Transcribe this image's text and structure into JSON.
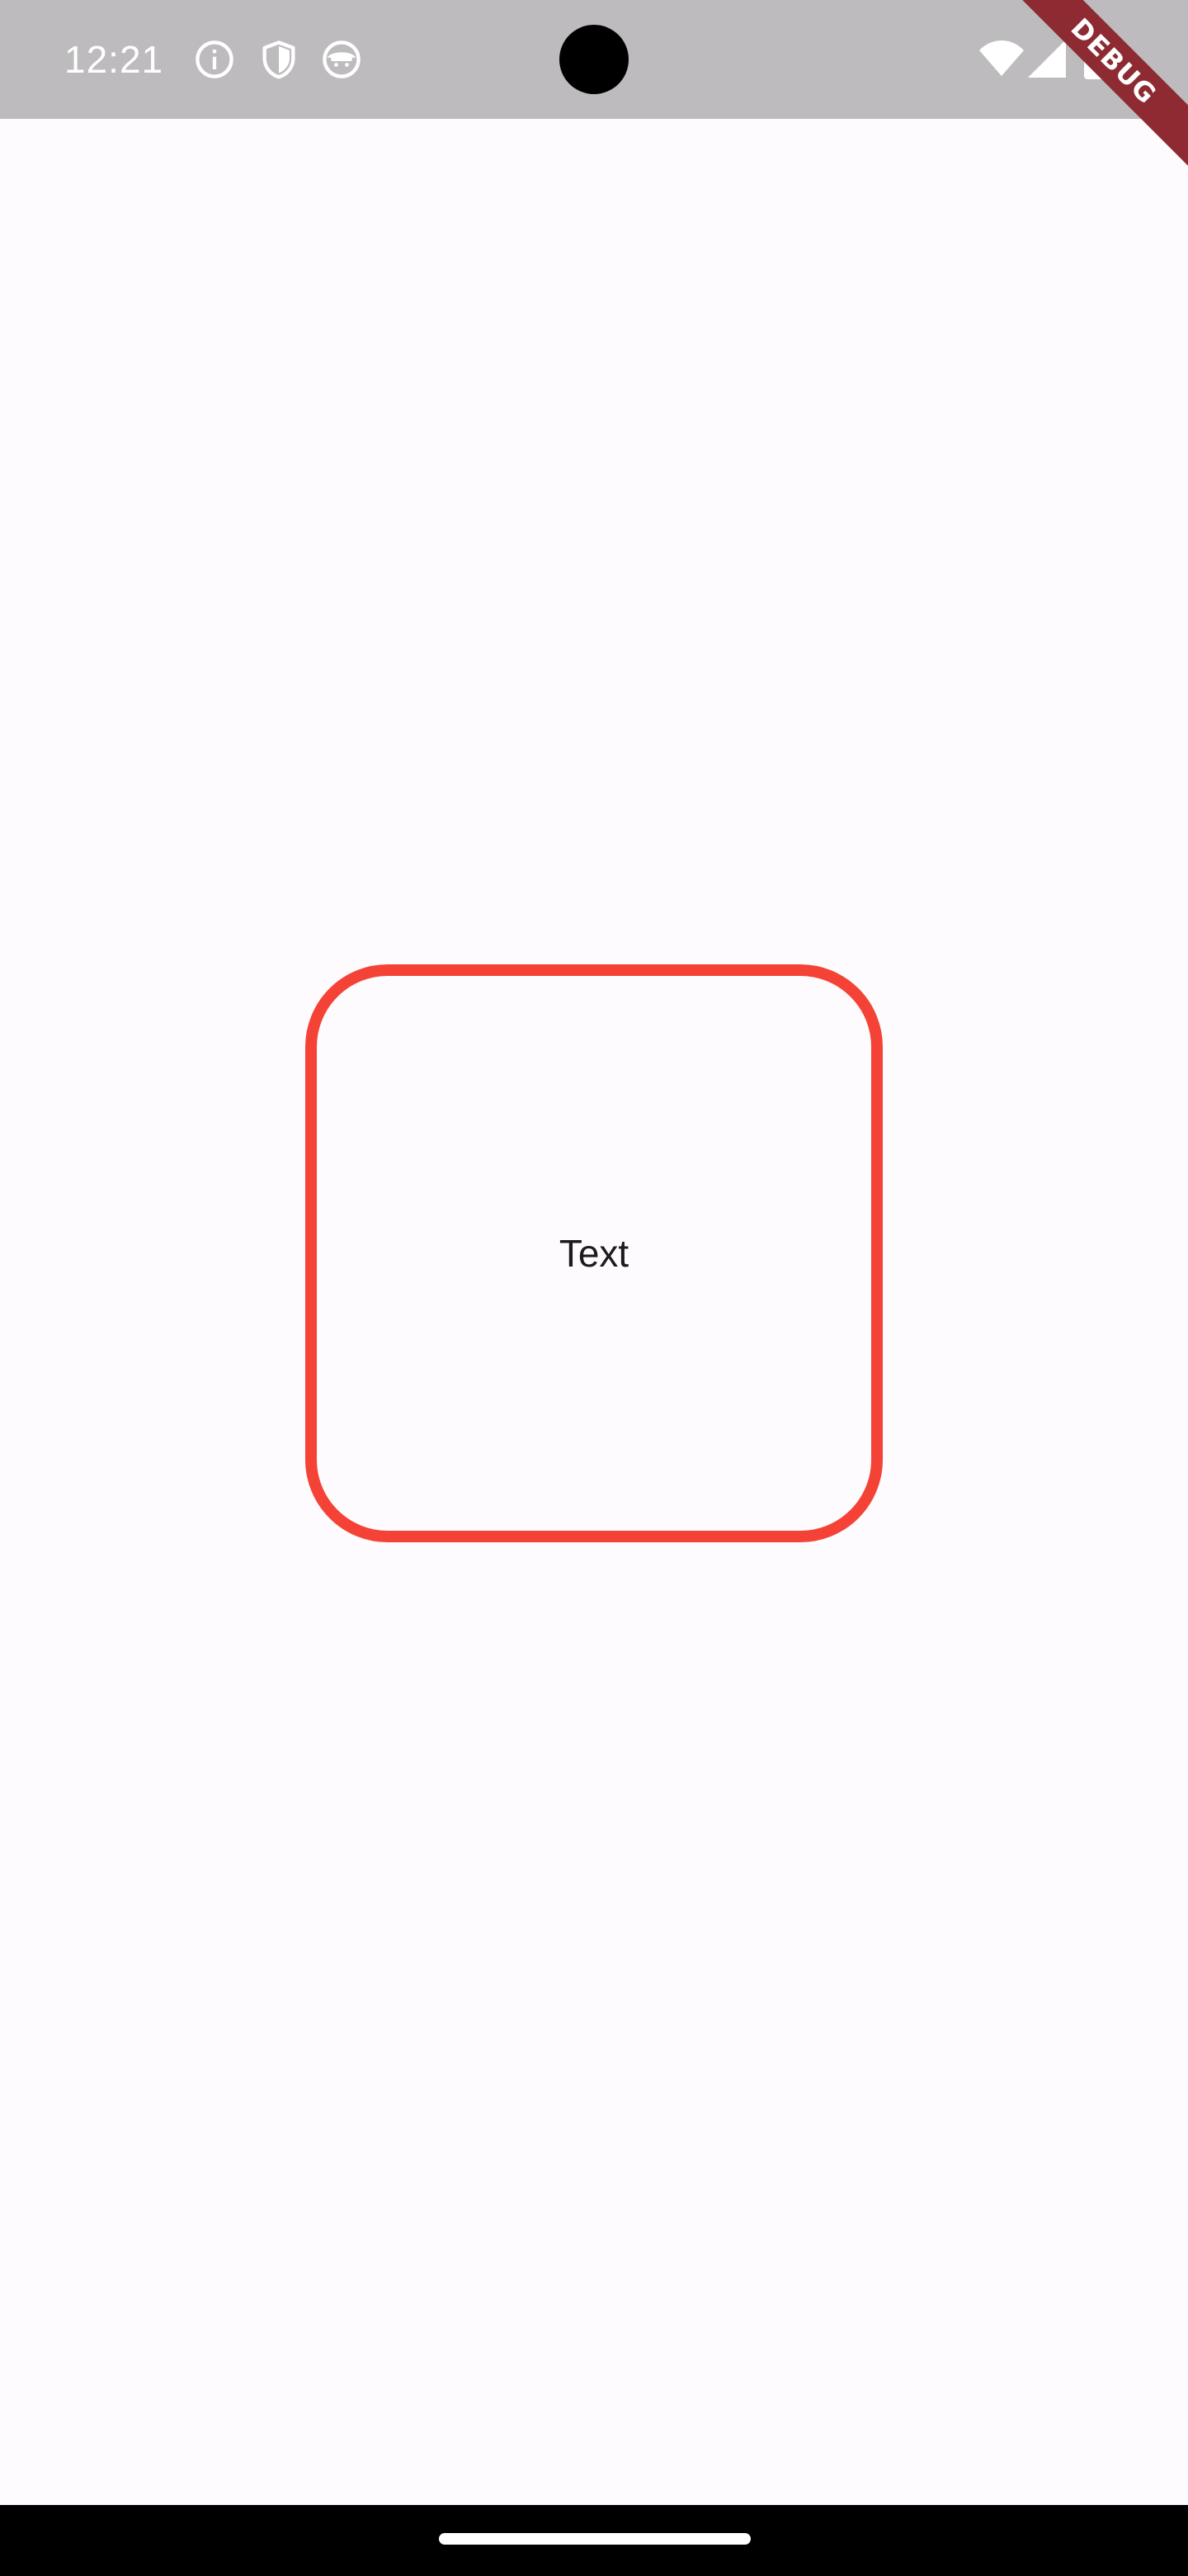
{
  "status_bar": {
    "time": "12:21",
    "left_icons": [
      "info-icon",
      "shield-icon",
      "face-icon"
    ],
    "right_icons": [
      "wifi-icon",
      "signal-icon",
      "battery-icon"
    ],
    "background_color": "#bdbbbd"
  },
  "debug_banner": {
    "label": "DEBUG",
    "color": "#8e2a32"
  },
  "main": {
    "box_text": "Text",
    "border_color": "#f44336",
    "background_color": "#fefbfe"
  },
  "nav_bar": {
    "background_color": "#000000"
  }
}
